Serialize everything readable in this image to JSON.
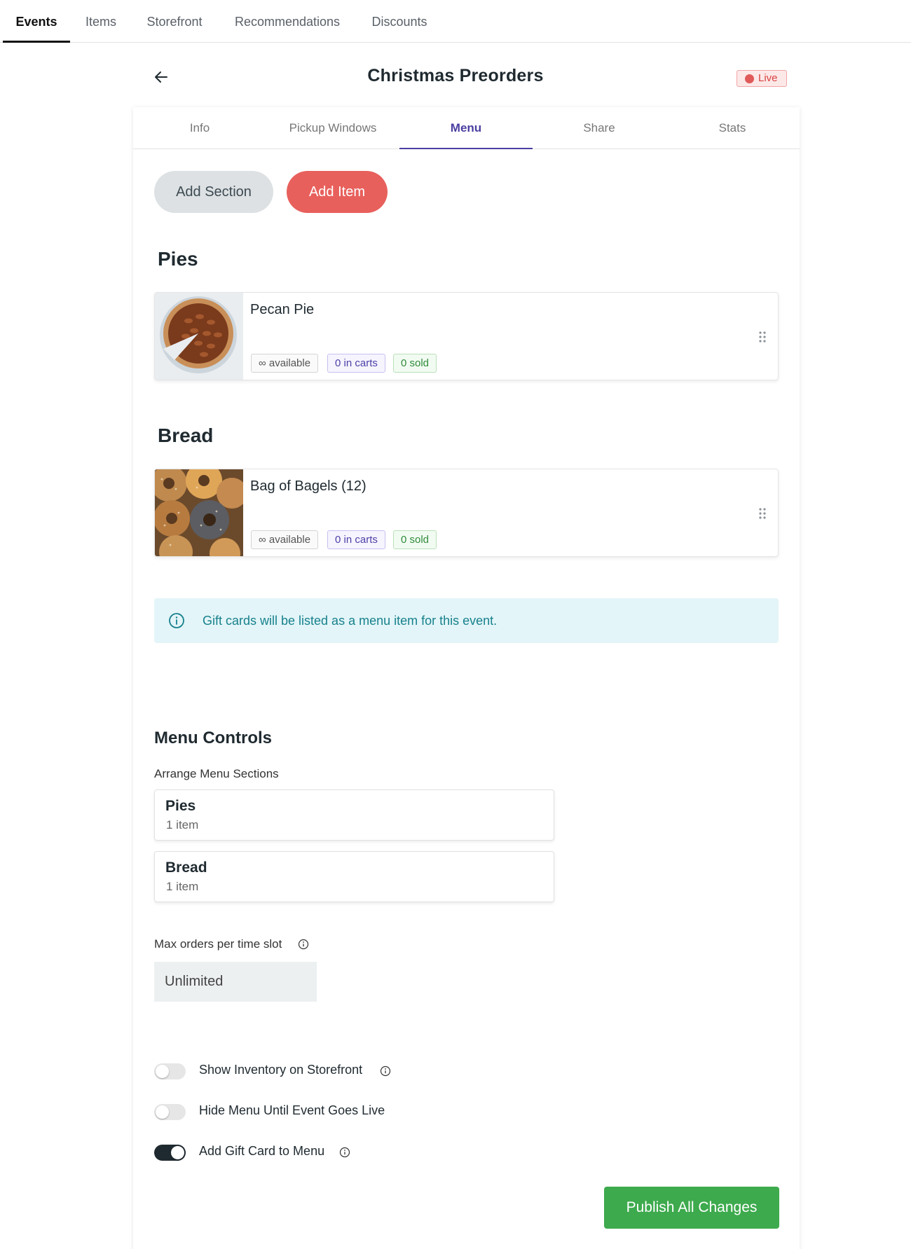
{
  "topnav": {
    "tabs": [
      {
        "label": "Events",
        "active": true
      },
      {
        "label": "Items",
        "active": false
      },
      {
        "label": "Storefront",
        "active": false
      },
      {
        "label": "Recommendations",
        "active": false
      },
      {
        "label": "Discounts",
        "active": false
      }
    ]
  },
  "header": {
    "title": "Christmas Preorders",
    "status": "Live"
  },
  "subtabs": [
    {
      "label": "Info",
      "active": false
    },
    {
      "label": "Pickup Windows",
      "active": false
    },
    {
      "label": "Menu",
      "active": true
    },
    {
      "label": "Share",
      "active": false
    },
    {
      "label": "Stats",
      "active": false
    }
  ],
  "actions": {
    "add_section": "Add Section",
    "add_item": "Add Item"
  },
  "sections": [
    {
      "name": "Pies",
      "items": [
        {
          "name": "Pecan Pie",
          "available": "∞ available",
          "carts": "0 in carts",
          "sold": "0 sold",
          "image": "pecan-pie-photo"
        }
      ]
    },
    {
      "name": "Bread",
      "items": [
        {
          "name": "Bag of Bagels (12)",
          "available": "∞ available",
          "carts": "0 in carts",
          "sold": "0 sold",
          "image": "bagels-photo"
        }
      ]
    }
  ],
  "gift_notice": "Gift cards will be listed as a menu item for this event.",
  "menu_controls": {
    "title": "Menu Controls",
    "arrange_label": "Arrange Menu Sections",
    "arrange": [
      {
        "name": "Pies",
        "count": "1 item"
      },
      {
        "name": "Bread",
        "count": "1 item"
      }
    ],
    "max_orders_label": "Max orders per time slot",
    "max_orders_value": "Unlimited",
    "toggles": [
      {
        "label": "Show Inventory on Storefront",
        "on": false,
        "info": true
      },
      {
        "label": "Hide Menu Until Event Goes Live",
        "on": false,
        "info": false
      },
      {
        "label": "Add Gift Card to Menu",
        "on": true,
        "info": true
      }
    ],
    "publish": "Publish All Changes"
  },
  "colors": {
    "accent_red": "#e8605c",
    "accent_purple": "#4a3fa0",
    "publish_green": "#3daa4d",
    "info_bg": "#e3f5f8"
  }
}
